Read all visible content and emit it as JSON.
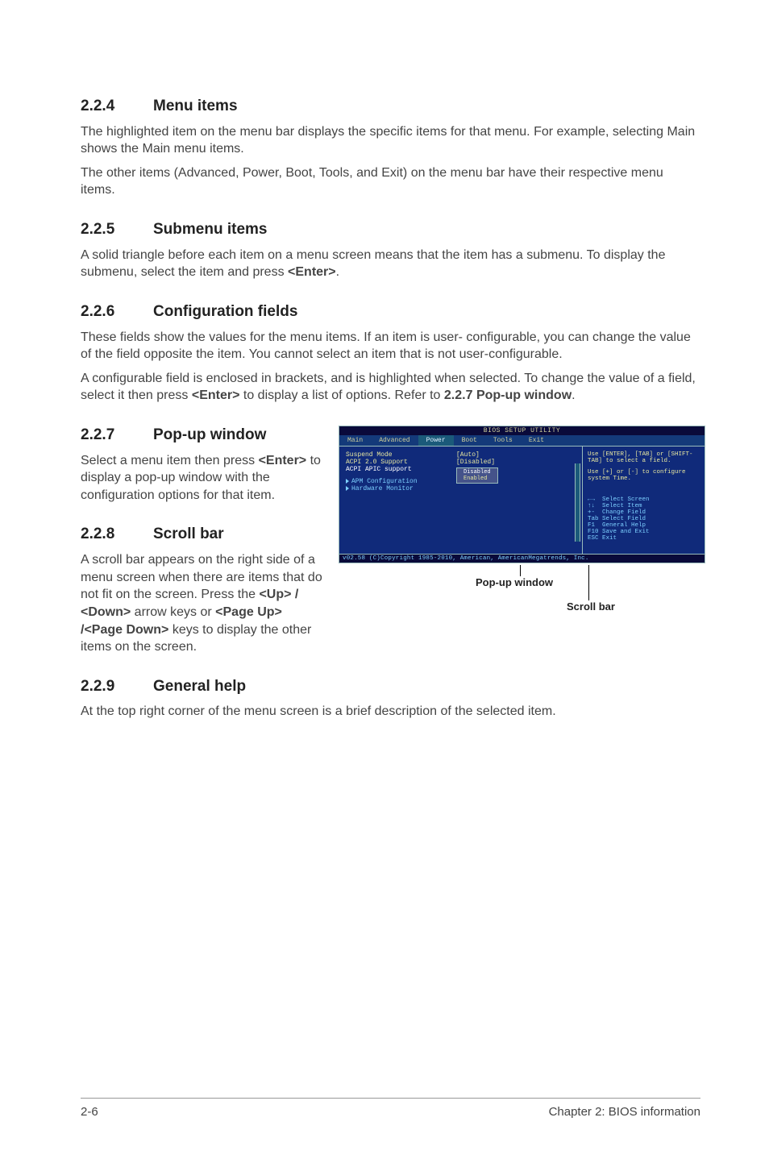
{
  "s224": {
    "num": "2.2.4",
    "title": "Menu items",
    "p1": "The highlighted item on the menu bar displays the specific items for that menu. For example, selecting Main shows the Main menu items.",
    "p2": "The other items (Advanced, Power, Boot, Tools, and Exit) on the menu bar have their respective menu items."
  },
  "s225": {
    "num": "2.2.5",
    "title": "Submenu items",
    "p1a": "A solid triangle before each item on a menu screen means that the item has a submenu. To display the submenu, select the item and press ",
    "p1b": "<Enter>",
    "p1c": "."
  },
  "s226": {
    "num": "2.2.6",
    "title": "Configuration fields",
    "p1": "These fields show the values for the menu items. If an item is user- configurable, you can change the value of the field opposite the item. You cannot select an item that is not user-configurable.",
    "p2a": "A configurable field is enclosed in brackets, and is highlighted when selected. To change the value of a field, select it then press ",
    "p2b": "<Enter>",
    "p2c": " to display a list of options. Refer to ",
    "p2d": "2.2.7 Pop-up window",
    "p2e": "."
  },
  "s227": {
    "num": "2.2.7",
    "title": "Pop-up window",
    "p1a": "Select a menu item then press ",
    "p1b": "<Enter>",
    "p1c": " to display a pop-up window with the configuration options for that item."
  },
  "s228": {
    "num": "2.2.8",
    "title": "Scroll bar",
    "p1a": "A scroll bar appears on the right side of a menu screen when there are items that do not fit on the screen. Press the ",
    "p1b": "<Up> / <Down>",
    "p1c": " arrow keys or ",
    "p1d": "<Page Up> /<Page Down>",
    "p1e": " keys to display the other items on the screen."
  },
  "s229": {
    "num": "2.2.9",
    "title": "General help",
    "p1": "At the top right corner of the menu screen is a brief description of the selected item."
  },
  "bios": {
    "title": "BIOS SETUP UTILITY",
    "menus": {
      "m1": "Main",
      "m2": "Advanced",
      "m3": "Power",
      "m4": "Boot",
      "m5": "Tools",
      "m6": "Exit"
    },
    "items": {
      "i1": "Suspend Mode",
      "i2": "ACPI 2.0 Support",
      "i3": "ACPI APIC support",
      "i4": "APM Configuration",
      "i5": "Hardware Monitor"
    },
    "vals": {
      "v1": "[Auto]",
      "v2": "[Disabled]"
    },
    "popup": {
      "o1": "Disabled",
      "o2": "Enabled"
    },
    "help": {
      "h1": "Use [ENTER], [TAB] or [SHIFT-TAB] to select a field.",
      "h2": "Use [+] or [-] to configure system Time.",
      "k1": "←→",
      "k1t": "Select Screen",
      "k2": "↑↓",
      "k2t": "Select Item",
      "k3": "+-",
      "k3t": "Change Field",
      "k4": "Tab",
      "k4t": "Select Field",
      "k5": "F1",
      "k5t": "General Help",
      "k6": "F10",
      "k6t": "Save and Exit",
      "k7": "ESC",
      "k7t": "Exit"
    },
    "footer": "v02.58 (C)Copyright 1985-2010, American, AmericanMegatrends, Inc."
  },
  "callouts": {
    "popup": "Pop-up window",
    "scroll": "Scroll bar"
  },
  "footer": {
    "left": "2-6",
    "right": "Chapter 2: BIOS information"
  }
}
